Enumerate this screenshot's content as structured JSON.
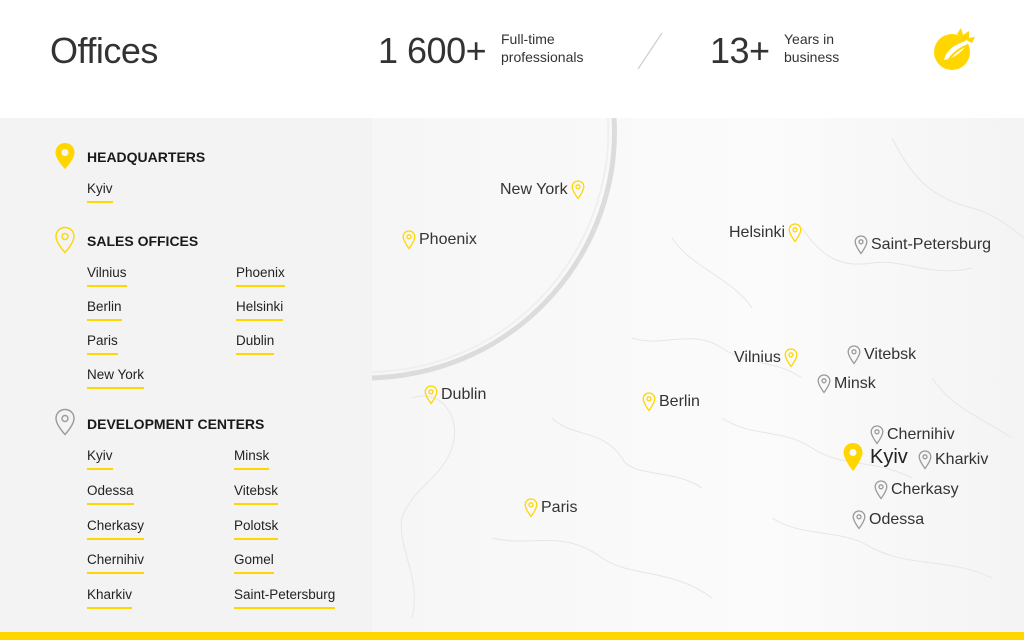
{
  "header": {
    "title": "Offices",
    "stat1": {
      "value": "1 600+",
      "label_line1": "Full-time",
      "label_line2": "professionals"
    },
    "stat2": {
      "value": "13+",
      "label_line1": "Years in",
      "label_line2": "business"
    },
    "logo_icon": "sunflower-logo-icon"
  },
  "sidebar": {
    "headquarters": {
      "title": "HEADQUARTERS",
      "icon": "filled-pin-icon",
      "items": [
        "Kyiv"
      ]
    },
    "sales": {
      "title": "SALES OFFICES",
      "icon": "yellow-outline-pin-icon",
      "col1": [
        "Vilnius",
        "Berlin",
        "Paris",
        "New York"
      ],
      "col2": [
        "Phoenix",
        "Helsinki",
        "Dublin"
      ]
    },
    "dev": {
      "title": "DEVELOPMENT CENTERS",
      "icon": "grey-outline-pin-icon",
      "col1": [
        "Kyiv",
        "Odessa",
        "Cherkasy",
        "Chernihiv",
        "Kharkiv"
      ],
      "col2": [
        "Minsk",
        "Vitebsk",
        "Polotsk",
        "Gomel",
        "Saint-Petersburg"
      ]
    }
  },
  "map": {
    "cities": {
      "new_york": "New York",
      "phoenix": "Phoenix",
      "helsinki": "Helsinki",
      "saint_petersburg": "Saint-Petersburg",
      "vilnius": "Vilnius",
      "vitebsk": "Vitebsk",
      "minsk": "Minsk",
      "dublin": "Dublin",
      "berlin": "Berlin",
      "chernihiv": "Chernihiv",
      "kyiv": "Kyiv",
      "kharkiv": "Kharkiv",
      "cherkasy": "Cherkasy",
      "paris": "Paris",
      "odessa": "Odessa"
    }
  },
  "colors": {
    "accent": "#ffd600",
    "panel_bg": "#f3f3f3",
    "grey_pin": "#9a9a9a"
  }
}
